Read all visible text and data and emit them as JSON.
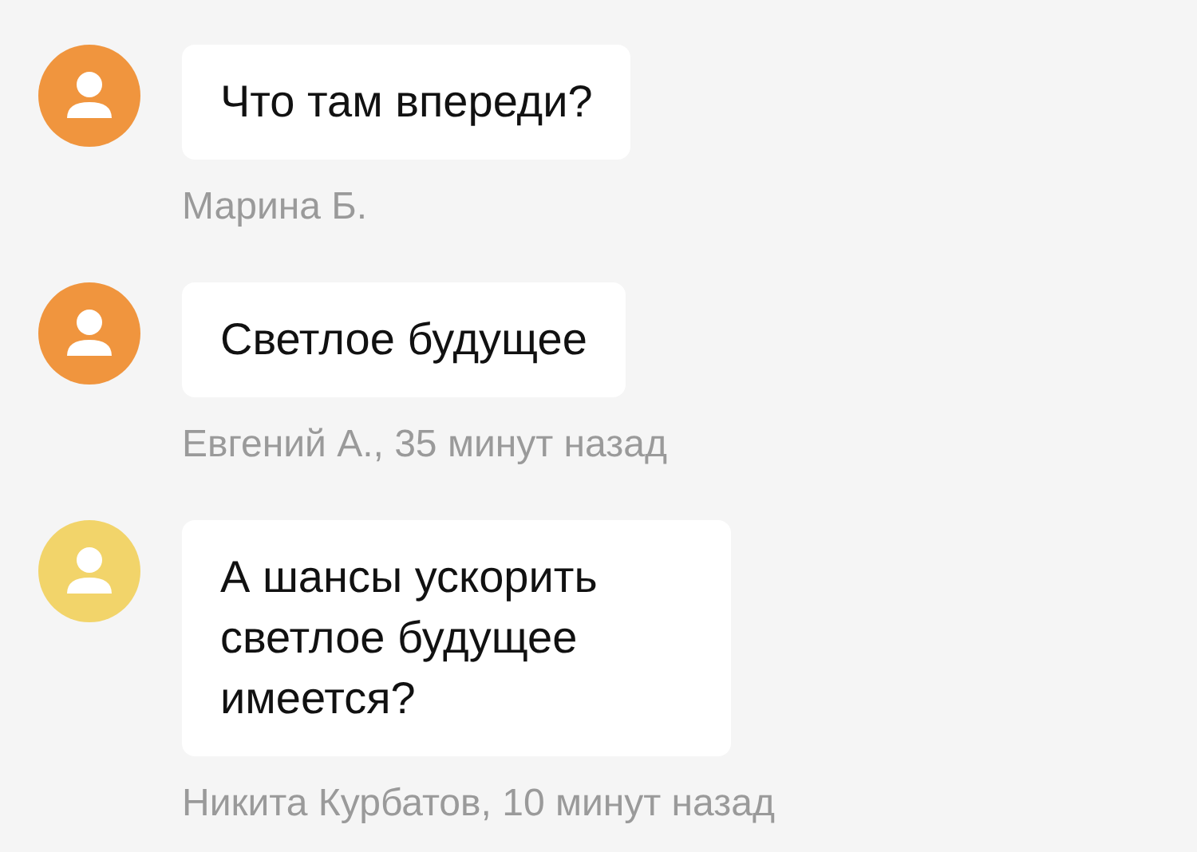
{
  "messages": [
    {
      "text": "Что там впереди?",
      "author": "Марина Б.",
      "color": "#f0953e"
    },
    {
      "text": "Светлое будущее",
      "author": "Евгений А., 35 минут назад",
      "color": "#f0953e"
    },
    {
      "text": "А шансы ускорить светлое будущее имеется?",
      "author": "Никита Курбатов, 10 минут назад",
      "color": "#f2d46a"
    }
  ]
}
